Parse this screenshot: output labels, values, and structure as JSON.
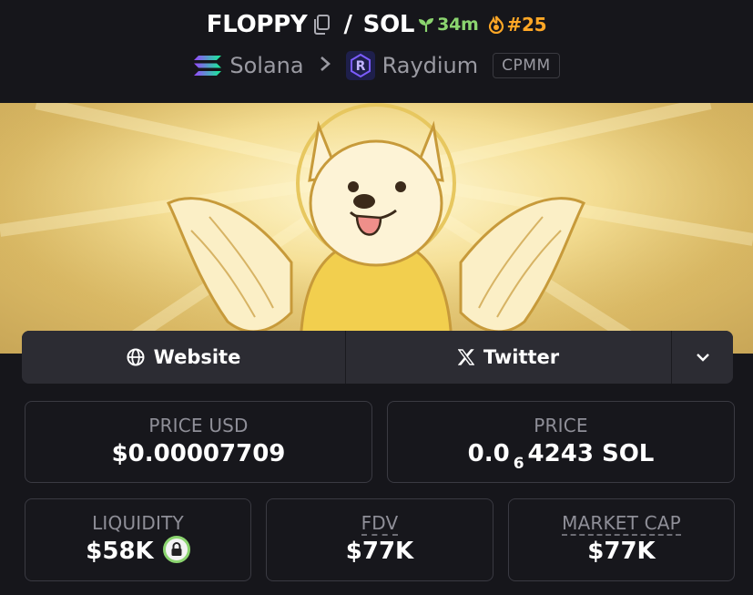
{
  "header": {
    "base_token": "FLOPPY",
    "separator": "/",
    "quote_token": "SOL",
    "age": "34m",
    "rank": "#25",
    "chain": "Solana",
    "dex": "Raydium",
    "pool_type": "CPMM"
  },
  "colors": {
    "age": "#8bd46f",
    "rank": "#ffa726",
    "lock_ring": "#8bd46f",
    "background": "#16161b",
    "card_border": "#3a3a42"
  },
  "icons": {
    "copy": "copy-icon",
    "age": "sprout-icon",
    "rank": "flame-icon",
    "chain": "solana-logo-icon",
    "dex": "raydium-logo-icon",
    "website": "globe-icon",
    "twitter": "x-logo-icon",
    "more": "chevron-down-icon",
    "liquidity": "lock-icon"
  },
  "links": {
    "website": "Website",
    "twitter": "Twitter"
  },
  "stats": {
    "price_usd_label": "PRICE USD",
    "price_usd_value": "$0.00007709",
    "price_label": "PRICE",
    "price_prefix": "0.0",
    "price_zeros": "6",
    "price_suffix": "4243 SOL",
    "liquidity_label": "LIQUIDITY",
    "liquidity_value": "$58K",
    "fdv_label": "FDV",
    "fdv_value": "$77K",
    "mcap_label": "MARKET CAP",
    "mcap_value": "$77K"
  }
}
